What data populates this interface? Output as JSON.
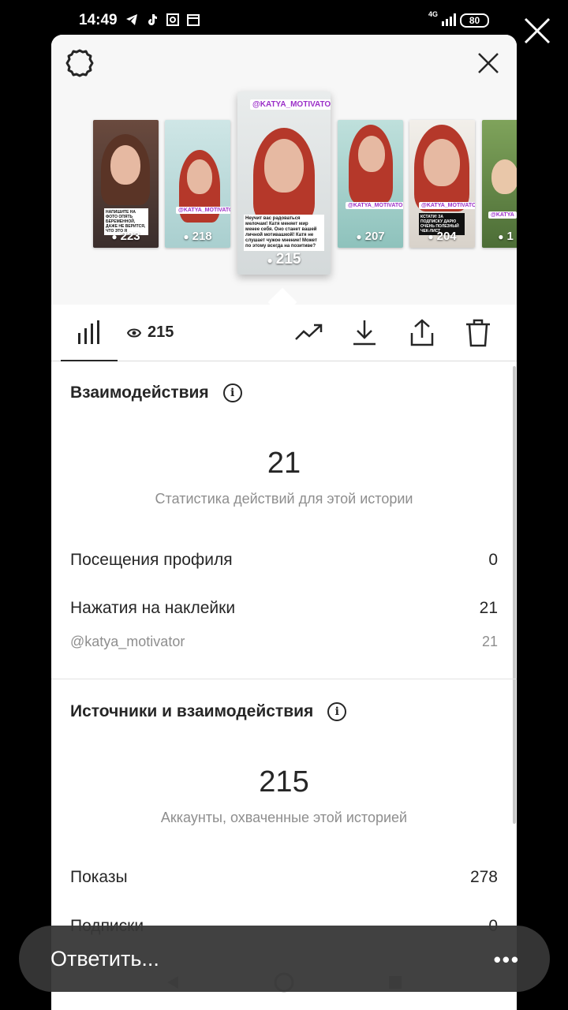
{
  "status_bar": {
    "time": "14:49",
    "network": "4G",
    "battery": "80"
  },
  "story_thumbnails": [
    {
      "views": "223",
      "caption": "НАПИШИТЕ НА ФОТО ОПЯТЬ БЕРЕМЕННОЙ, ДАЖЕ НЕ ВЕРИТСЯ, ЧТО ЭТО Я"
    },
    {
      "views": "218",
      "tag": "@KATYA_MOTIVATOR"
    },
    {
      "views": "215",
      "tag": "@KATYA_MOTIVATOR",
      "caption": "Неучит вас радоваться мелочам! Катя меняет мир менее себя. Оно станет вашей личной мотивашкой! Катя не слушает чужое мнение! Может по этому всегда на позитиве?"
    },
    {
      "views": "207",
      "tag": "@KATYA_MOTIVATOR"
    },
    {
      "views": "204",
      "tag": "@KATYA_MOTIVATOR",
      "caption": "КСТАТИ! ЗА ПОДПИСКУ ДАРЮ ОЧЕНЬ ПОЛЕЗНЫЙ ЧЕК-ЛИСТ"
    },
    {
      "views": "1",
      "tag": "@KATYA"
    }
  ],
  "toolbar": {
    "views_count": "215"
  },
  "interactions": {
    "title": "Взаимодействия",
    "total": "21",
    "subtitle": "Статистика действий для этой истории",
    "rows": [
      {
        "label": "Посещения профиля",
        "value": "0"
      },
      {
        "label": "Нажатия на наклейки",
        "value": "21"
      }
    ],
    "sub_row": {
      "label": "@katya_motivator",
      "value": "21"
    }
  },
  "discovery": {
    "title": "Источники и взаимодействия",
    "total": "215",
    "subtitle": "Аккаунты, охваченные этой историей",
    "rows": [
      {
        "label": "Показы",
        "value": "278"
      },
      {
        "label": "Подписки",
        "value": "0"
      }
    ]
  },
  "reply_bar": {
    "placeholder": "Ответить...",
    "more": "•••"
  },
  "icons": {
    "settings": "gear-icon",
    "close": "close-icon",
    "insights": "bar-chart-icon",
    "eye": "eye-icon",
    "promote": "trending-up-icon",
    "download": "download-icon",
    "share": "share-icon",
    "delete": "trash-icon"
  }
}
